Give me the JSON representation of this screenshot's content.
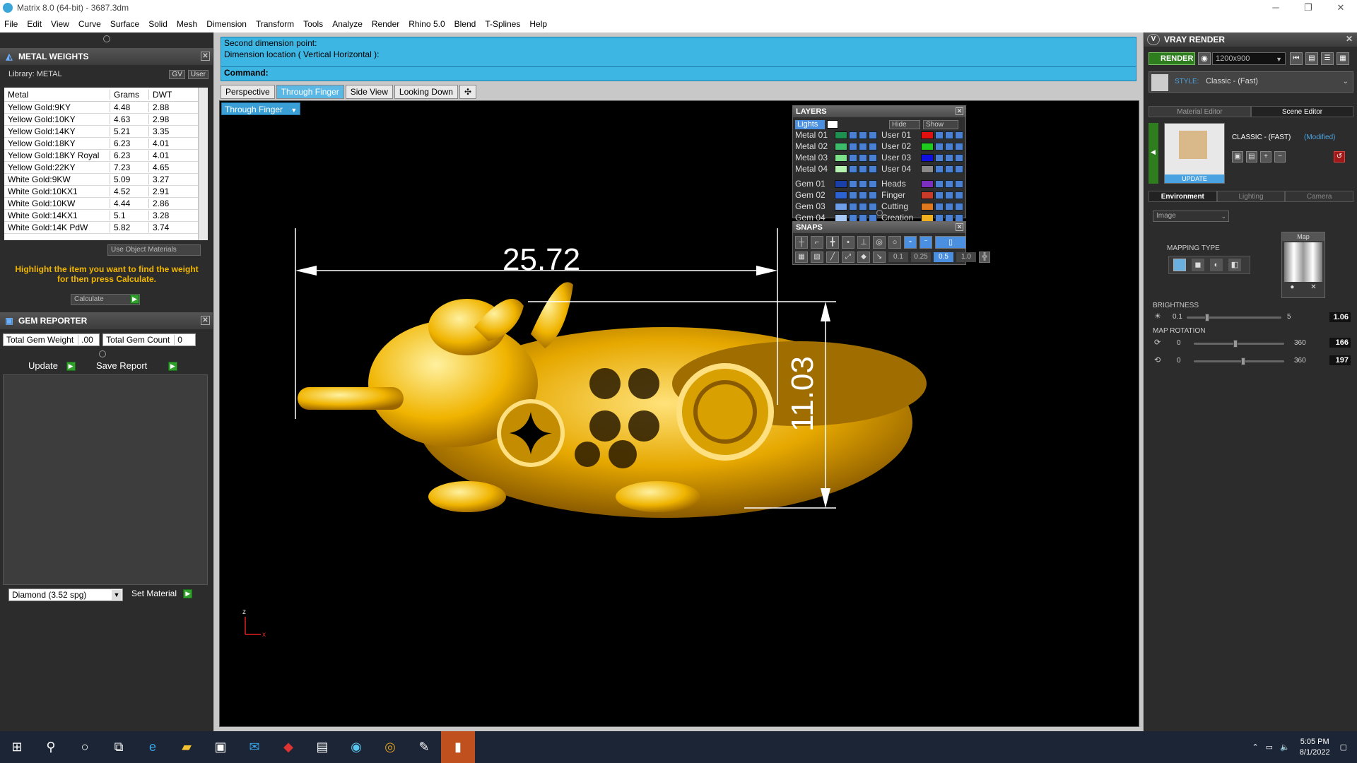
{
  "window": {
    "title": "Matrix 8.0 (64-bit) - 3687.3dm"
  },
  "menu": [
    "File",
    "Edit",
    "View",
    "Curve",
    "Surface",
    "Solid",
    "Mesh",
    "Dimension",
    "Transform",
    "Tools",
    "Analyze",
    "Render",
    "Rhino 5.0",
    "Blend",
    "T-Splines",
    "Help"
  ],
  "metal_weights": {
    "title": "METAL WEIGHTS",
    "library": "Library: METAL",
    "gv": "GV",
    "user": "User",
    "columns": [
      "Metal",
      "Grams",
      "DWT"
    ],
    "rows": [
      [
        "Yellow Gold:9KY",
        "4.48",
        "2.88"
      ],
      [
        "Yellow Gold:10KY",
        "4.63",
        "2.98"
      ],
      [
        "Yellow Gold:14KY",
        "5.21",
        "3.35"
      ],
      [
        "Yellow Gold:18KY",
        "6.23",
        "4.01"
      ],
      [
        "Yellow Gold:18KY Royal",
        "6.23",
        "4.01"
      ],
      [
        "Yellow Gold:22KY",
        "7.23",
        "4.65"
      ],
      [
        "White Gold:9KW",
        "5.09",
        "3.27"
      ],
      [
        "White Gold:10KX1",
        "4.52",
        "2.91"
      ],
      [
        "White Gold:10KW",
        "4.44",
        "2.86"
      ],
      [
        "White Gold:14KX1",
        "5.1",
        "3.28"
      ],
      [
        "White Gold:14K PdW",
        "5.82",
        "3.74"
      ]
    ],
    "use_object_materials": "Use Object Materials",
    "hint": "Highlight the item you want to find the weight for then press Calculate.",
    "calculate": "Calculate"
  },
  "gem_reporter": {
    "title": "GEM REPORTER",
    "total_weight_label": "Total Gem Weight",
    "total_weight_value": ".00",
    "total_count_label": "Total Gem Count",
    "total_count_value": "0",
    "update": "Update",
    "save_report": "Save Report",
    "material_select": "Diamond   (3.52 spg)",
    "set_material": "Set Material"
  },
  "command": {
    "line1": "Second dimension point:",
    "line2": "Dimension location ( Vertical  Horizontal ):",
    "prompt": "Command:"
  },
  "view_tabs": [
    "Perspective",
    "Through Finger",
    "Side View",
    "Looking Down"
  ],
  "active_view": "Through Finger",
  "dimensions": {
    "horizontal": "25.72",
    "vertical": "11.03"
  },
  "axis": {
    "z": "z",
    "x": "x"
  },
  "layers": {
    "title": "LAYERS",
    "lights": "Lights",
    "hide": "Hide",
    "show": "Show",
    "left": [
      {
        "name": "Metal 01",
        "color": "#1e8f4e"
      },
      {
        "name": "Metal 02",
        "color": "#3dbb6a"
      },
      {
        "name": "Metal 03",
        "color": "#7ee08b"
      },
      {
        "name": "Metal 04",
        "color": "#b6f2b0"
      },
      {
        "name": "Gem 01",
        "color": "#1a3fa6"
      },
      {
        "name": "Gem 02",
        "color": "#2d63d0"
      },
      {
        "name": "Gem 03",
        "color": "#6f9fe8"
      },
      {
        "name": "Gem 04",
        "color": "#a9c8f4"
      }
    ],
    "right": [
      {
        "name": "User 01",
        "color": "#e01010"
      },
      {
        "name": "User 02",
        "color": "#1ecb1e"
      },
      {
        "name": "User 03",
        "color": "#1010e0"
      },
      {
        "name": "User 04",
        "color": "#8a8a8a"
      },
      {
        "name": "Heads",
        "color": "#7b2fbf"
      },
      {
        "name": "Finger",
        "color": "#c83a2a"
      },
      {
        "name": "Cutting",
        "color": "#e07820"
      },
      {
        "name": "Creation",
        "color": "#f0b020"
      }
    ]
  },
  "snaps": {
    "title": "SNAPS",
    "values": [
      "0.1",
      "0.25",
      "0.5",
      "1.0"
    ]
  },
  "vray": {
    "title": "VRAY RENDER",
    "render": "RENDER",
    "resolution": "1200x900",
    "style_label": "STYLE:",
    "style_value": "Classic - (Fast)",
    "tabs": [
      "Material Editor",
      "Scene Editor"
    ],
    "scene_title": "CLASSIC - (FAST)",
    "scene_modified": "(Modified)",
    "update": "UPDATE",
    "env_tabs": [
      "Environment",
      "Lighting",
      "Camera"
    ],
    "image_select": "Image",
    "mapping_type": "MAPPING TYPE",
    "map": "Map",
    "brightness": "BRIGHTNESS",
    "brightness_min": "0.1",
    "brightness_max": "5",
    "brightness_value": "1.06",
    "brightness_level": 0.2,
    "map_rotation": "MAP ROTATION",
    "rot_min": "0",
    "rot_max": "360",
    "rot1_value": "166",
    "rot1_level": 0.46,
    "rot2_value": "197",
    "rot2_level": 0.55
  },
  "taskbar": {
    "time": "5:05 PM",
    "date": "8/1/2022"
  },
  "colors": {
    "accent": "#3eb6e4",
    "gold": "#f2b700",
    "render_green": "#2e7d1e"
  }
}
